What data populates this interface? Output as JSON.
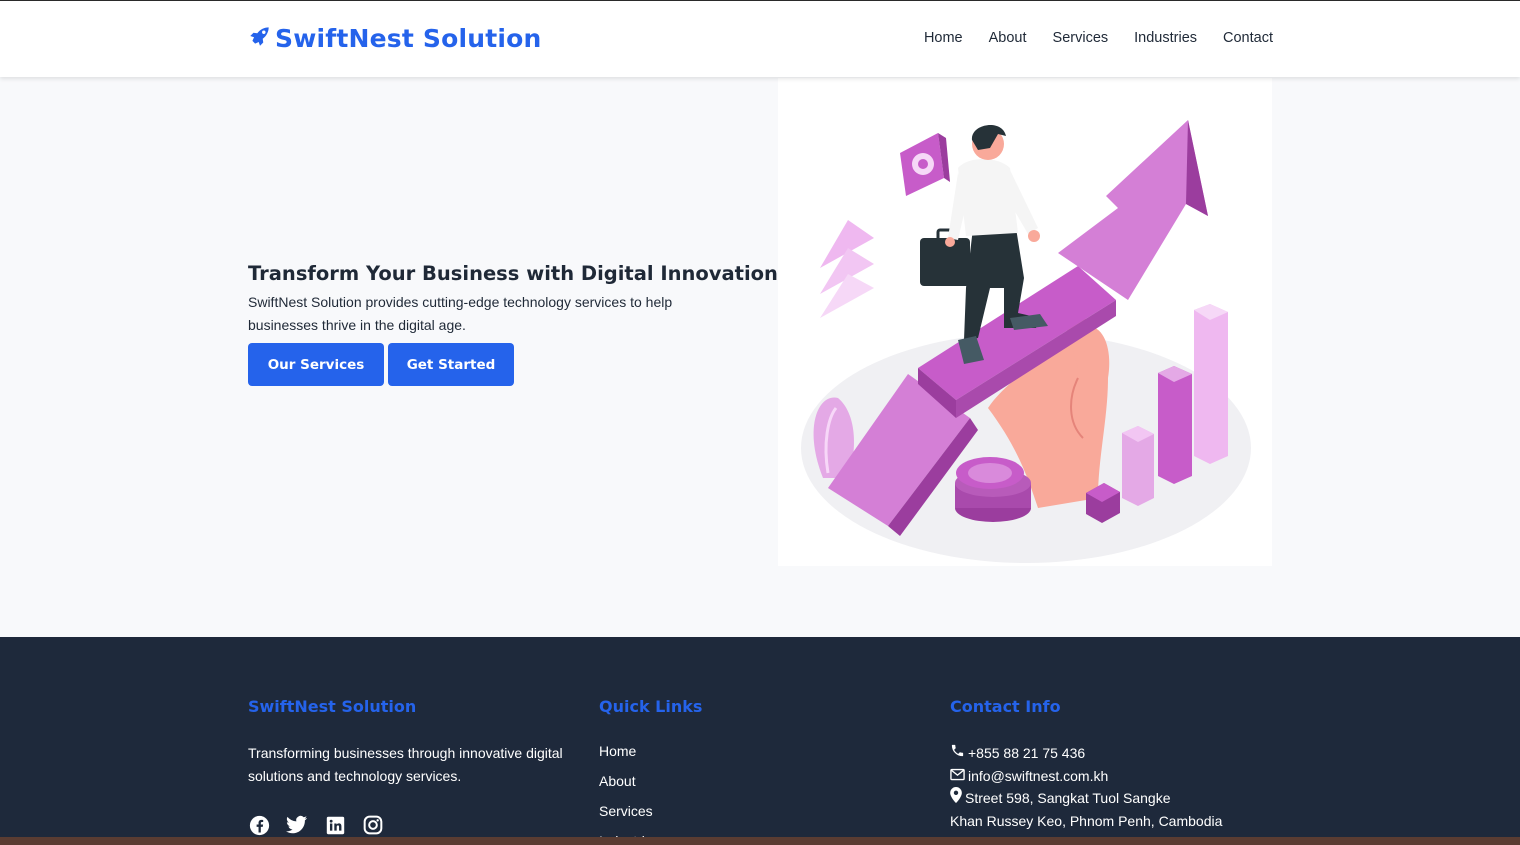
{
  "header": {
    "brand": "SwiftNest Solution",
    "nav": [
      "Home",
      "About",
      "Services",
      "Industries",
      "Contact"
    ]
  },
  "hero": {
    "title": "Transform Your Business with Digital Innovation",
    "subtitle": "SwiftNest Solution provides cutting-edge technology services to help businesses thrive in the digital age.",
    "btn_services": "Our Services",
    "btn_start": "Get Started"
  },
  "footer": {
    "col1_title": "SwiftNest Solution",
    "col1_desc": "Transforming businesses through innovative digital solutions and technology services.",
    "social": [
      "facebook-icon",
      "twitter-icon",
      "linkedin-icon",
      "instagram-icon"
    ],
    "col2_title": "Quick Links",
    "links": [
      "Home",
      "About",
      "Services",
      "Industries"
    ],
    "col3_title": "Contact Info",
    "phone": "+855 88 21 75 436",
    "email": "info@swiftnest.com.kh",
    "address1": "Street 598, Sangkat Tuol Sangke",
    "address2": "Khan Russey Keo, Phnom Penh, Cambodia"
  },
  "colors": {
    "primary": "#2563eb",
    "footer_bg": "#1e293b",
    "accent_purple": "#c75cc9"
  }
}
